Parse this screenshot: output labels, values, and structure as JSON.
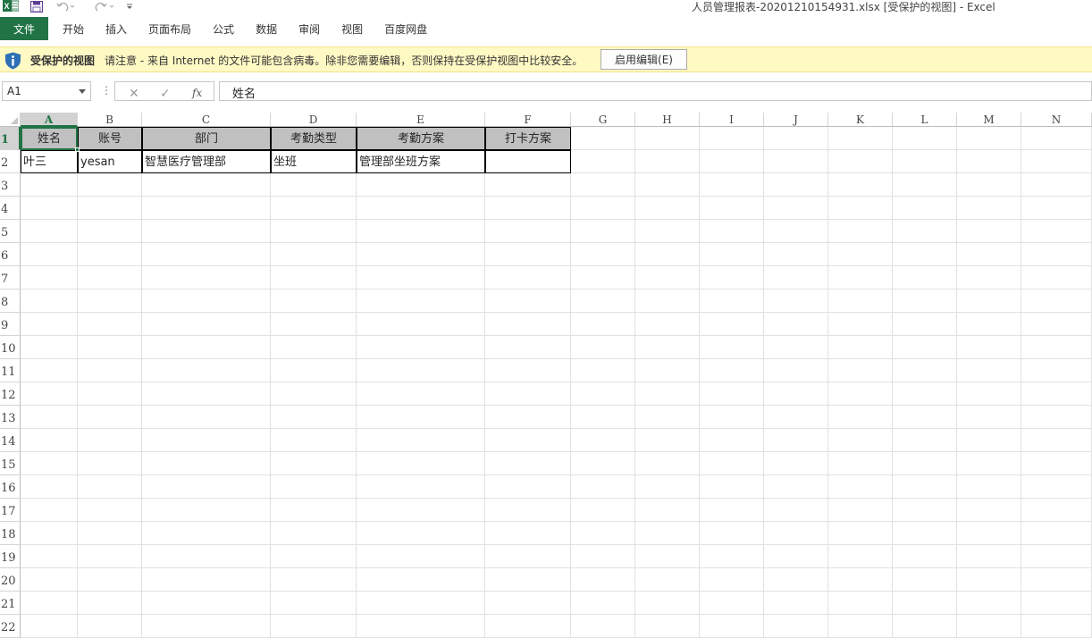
{
  "window": {
    "title": "人员管理报表-20201210154931.xlsx  [受保护的视图] - Excel"
  },
  "quick_access": {
    "save_icon": "save-icon",
    "undo_icon": "undo-icon",
    "redo_icon": "redo-icon",
    "customize_icon": "customize-icon"
  },
  "ribbon": {
    "tabs": [
      "文件",
      "开始",
      "插入",
      "页面布局",
      "公式",
      "数据",
      "审阅",
      "视图",
      "百度网盘"
    ]
  },
  "protected_view": {
    "title": "受保护的视图",
    "message": "请注意 - 来自 Internet 的文件可能包含病毒。除非您需要编辑，否则保持在受保护视图中比较安全。",
    "button": "启用编辑(E)"
  },
  "formula_bar": {
    "name_box": "A1",
    "formula": "姓名",
    "fx_label": "fx"
  },
  "sheet": {
    "columns": [
      "A",
      "B",
      "C",
      "D",
      "E",
      "F",
      "G",
      "H",
      "I",
      "J",
      "K",
      "L",
      "M",
      "N"
    ],
    "rows": [
      "1",
      "2",
      "3",
      "4",
      "5",
      "6",
      "7",
      "8",
      "9",
      "10",
      "11",
      "12",
      "13",
      "14",
      "15",
      "16",
      "17",
      "18",
      "19",
      "20",
      "21",
      "22"
    ],
    "header_row": [
      "姓名",
      "账号",
      "部门",
      "考勤类型",
      "考勤方案",
      "打卡方案"
    ],
    "data_row": [
      "叶三",
      "yesan",
      "智慧医疗管理部",
      "坐班",
      "管理部坐班方案",
      ""
    ],
    "active_cell": "A1"
  },
  "colors": {
    "excel_green": "#217346",
    "protected_bar": "#fff9c4",
    "header_fill": "#c0c0c0"
  }
}
